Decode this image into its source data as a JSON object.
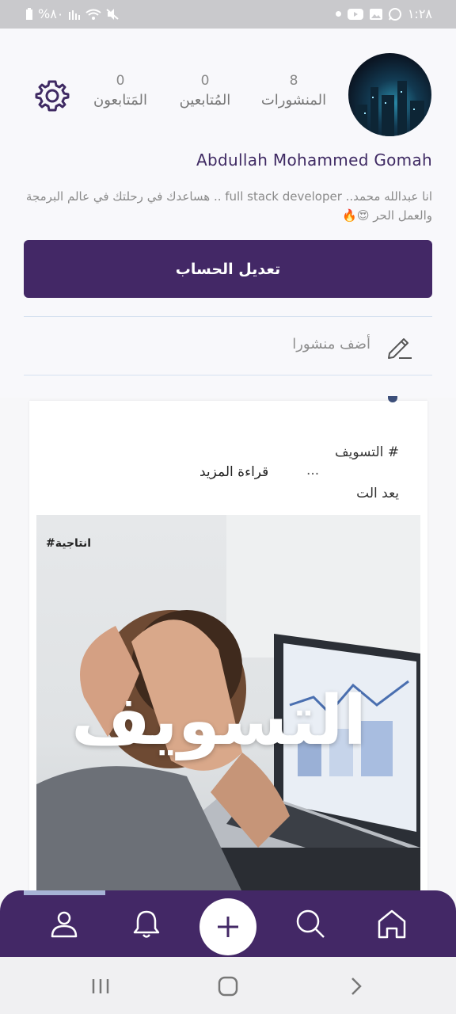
{
  "status_bar": {
    "battery": "%٨٠",
    "time": "١:٢٨"
  },
  "profile": {
    "stats": [
      {
        "label": "المنشورات",
        "value": "8"
      },
      {
        "label": "المُتابعين",
        "value": "0"
      },
      {
        "label": "المَتابعون",
        "value": "0"
      }
    ],
    "name": "Abdullah Mohammed Gomah",
    "bio": "انا عبدالله محمد.. full stack developer .. هساعدك في رحلتك في عالم البرمجة والعمل الحر 😍🔥",
    "edit_button": "تعديل الحساب",
    "add_post_label": "أضف منشورا"
  },
  "post": {
    "text_line1": "# التسويف",
    "text_line3": "يعد الت",
    "ellipsis": "...",
    "read_more": "قراءة المزيد",
    "image_tag": "#انتاجية",
    "image_title": "التسويف"
  },
  "nav": {
    "items": [
      "profile-icon",
      "bell-icon",
      "add-icon",
      "search-icon",
      "home-icon"
    ]
  },
  "colors": {
    "primary": "#432866",
    "accent": "#a7b3d6"
  }
}
